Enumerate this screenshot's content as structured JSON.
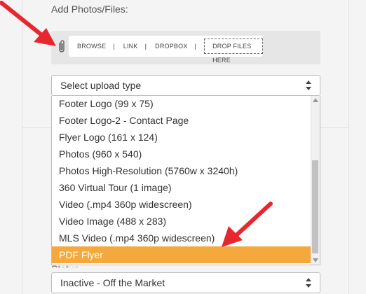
{
  "section": {
    "label": "Add Photos/Files:"
  },
  "uploader": {
    "browse": "BROWSE",
    "link": "LINK",
    "dropbox": "DROPBOX",
    "drop_files": "DROP FILES HERE",
    "separator": "|"
  },
  "upload_type_select": {
    "value": "Select upload type",
    "options": [
      "Footer Logo (99 x 75)",
      "Footer Logo-2 - Contact Page",
      "Flyer Logo (161 x 124)",
      "Photos (960 x 540)",
      "Photos High-Resolution (5760w x 3240h)",
      "360 Virtual Tour (1 image)",
      "Video (.mp4 360p widescreen)",
      "Video Image (488 x 283)",
      "MLS Video (.mp4 360p widescreen)",
      "PDF Flyer"
    ],
    "selected_option": "PDF Flyer"
  },
  "status_select": {
    "label": "Status",
    "value": "Inactive - Off the Market"
  },
  "colors": {
    "highlight": "#f5a93c",
    "annotation_arrow": "#e8262e"
  },
  "icons": {
    "attach": "paperclip-icon",
    "select_arrows": "up-down-arrows-icon"
  }
}
